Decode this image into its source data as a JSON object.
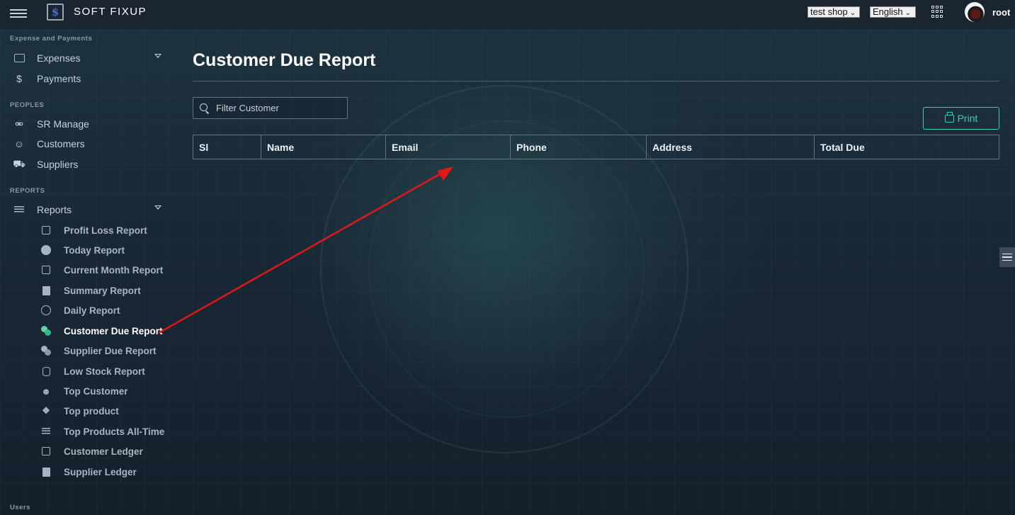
{
  "topbar": {
    "brand": "SOFT FIXUP",
    "shop_select": "test shop",
    "language_select": "English",
    "username": "root"
  },
  "sidebar": {
    "section_expense": "Expense and Payments",
    "expenses": "Expenses",
    "payments": "Payments",
    "section_peoples": "PEOPLES",
    "sr_manage": "SR Manage",
    "customers": "Customers",
    "suppliers": "Suppliers",
    "section_reports": "REPORTS",
    "reports": "Reports",
    "report_items": [
      "Profit Loss Report",
      "Today Report",
      "Current Month Report",
      "Summary Report",
      "Daily Report",
      "Customer Due Report",
      "Supplier Due Report",
      "Low Stock Report",
      "Top Customer",
      "Top product",
      "Top Products All-Time",
      "Customer Ledger",
      "Supplier Ledger"
    ],
    "section_users": "Users"
  },
  "main": {
    "title": "Customer Due Report",
    "filter_placeholder": "Filter Customer",
    "print_label": "Print",
    "columns": [
      "Sl",
      "Name",
      "Email",
      "Phone",
      "Address",
      "Total Due"
    ]
  },
  "colors": {
    "accent": "#3fcf9f",
    "annotation_arrow": "#e01818"
  }
}
